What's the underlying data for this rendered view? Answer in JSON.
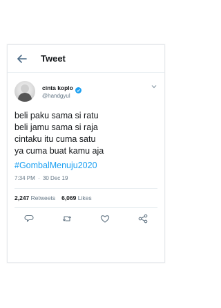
{
  "header": {
    "title": "Tweet"
  },
  "author": {
    "name": "cinta koplo",
    "handle": "@handgyul"
  },
  "tweet": {
    "lines": [
      "beli paku sama si ratu",
      "beli jamu sama si raja",
      "cintaku itu cuma satu",
      "ya cuma buat kamu aja"
    ],
    "hashtag": "#GombalMenuju2020",
    "time": "7:34 PM",
    "separator": "·",
    "date": "30 Dec 19"
  },
  "stats": {
    "retweets_count": "2,247",
    "retweets_label": "Retweets",
    "likes_count": "6,069",
    "likes_label": "Likes"
  },
  "colors": {
    "accent": "#1da1f2",
    "text": "#14171a",
    "muted": "#657786",
    "icon": "#657786"
  },
  "icons": [
    "back-arrow-icon",
    "verified-badge-icon",
    "chevron-down-icon",
    "reply-icon",
    "retweet-icon",
    "like-icon",
    "share-icon"
  ]
}
